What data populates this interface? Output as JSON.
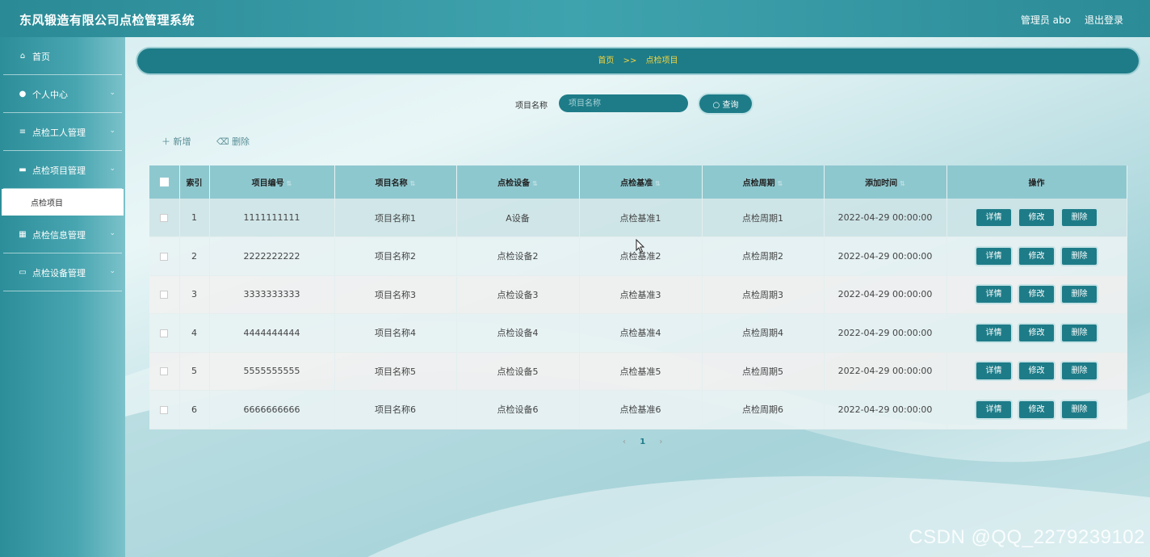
{
  "header": {
    "title": "东风锻造有限公司点检管理系统",
    "user": "管理员 abo",
    "logout": "退出登录"
  },
  "sidebar": {
    "items": [
      {
        "label": "首页",
        "icon": "home-icon"
      },
      {
        "label": "个人中心",
        "icon": "user-icon"
      },
      {
        "label": "点检工人管理",
        "icon": "list-icon"
      },
      {
        "label": "点检项目管理",
        "icon": "chat-icon"
      },
      {
        "label": "点检信息管理",
        "icon": "grid-icon"
      },
      {
        "label": "点检设备管理",
        "icon": "briefcase-icon"
      }
    ],
    "submenu": {
      "label": "点检项目"
    }
  },
  "breadcrumb": {
    "home": "首页",
    "sep": ">>",
    "current": "点检项目"
  },
  "search": {
    "label": "项目名称",
    "placeholder": "项目名称",
    "button": "查询"
  },
  "actions": {
    "add": "新增",
    "delete": "删除"
  },
  "table": {
    "headers": [
      "索引",
      "项目编号",
      "项目名称",
      "点检设备",
      "点检基准",
      "点检周期",
      "添加时间",
      "操作"
    ],
    "buttons": {
      "detail": "详情",
      "edit": "修改",
      "delete": "删除"
    },
    "rows": [
      [
        "1",
        "1111111111",
        "项目名称1",
        "A设备",
        "点检基准1",
        "点检周期1",
        "2022-04-29 00:00:00"
      ],
      [
        "2",
        "2222222222",
        "项目名称2",
        "点检设备2",
        "点检基准2",
        "点检周期2",
        "2022-04-29 00:00:00"
      ],
      [
        "3",
        "3333333333",
        "项目名称3",
        "点检设备3",
        "点检基准3",
        "点检周期3",
        "2022-04-29 00:00:00"
      ],
      [
        "4",
        "4444444444",
        "项目名称4",
        "点检设备4",
        "点检基准4",
        "点检周期4",
        "2022-04-29 00:00:00"
      ],
      [
        "5",
        "5555555555",
        "项目名称5",
        "点检设备5",
        "点检基准5",
        "点检周期5",
        "2022-04-29 00:00:00"
      ],
      [
        "6",
        "6666666666",
        "项目名称6",
        "点检设备6",
        "点检基准6",
        "点检周期6",
        "2022-04-29 00:00:00"
      ]
    ]
  },
  "pagination": {
    "prev": "‹",
    "current": "1",
    "next": "›"
  },
  "watermark": "CSDN @QQ_2279239102",
  "colors": {
    "primary": "#1e7c88",
    "header": "#2a8a96",
    "crumb_text": "#f5d43c"
  }
}
